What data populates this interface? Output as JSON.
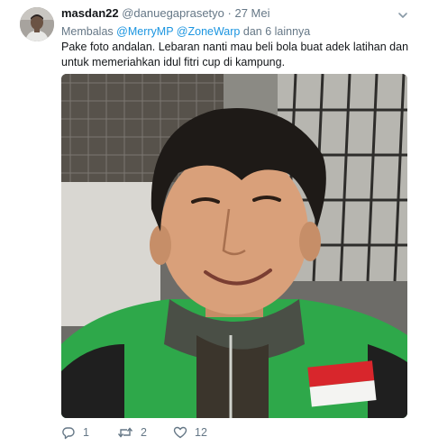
{
  "tweet": {
    "display_name": "masdan22",
    "handle": "@danuegaprasetyo",
    "separator": "·",
    "date": "27 Mei",
    "reply_prefix": "Membalas",
    "reply_mention_1": "@MerryMP",
    "reply_mention_2": "@ZoneWarp",
    "reply_suffix": "dan 6 lainnya",
    "text": "Pake foto andalan. Lebaran nanti mau beli bola buat adek latihan dan untuk memeriahkan idul fitri cup di kampung.",
    "reply_count": "1",
    "retweet_count": "2",
    "like_count": "12"
  },
  "icons": {
    "avatar": "avatar",
    "caret": "chevron-down-icon",
    "reply": "reply-icon",
    "retweet": "retweet-icon",
    "like": "heart-icon"
  },
  "colors": {
    "text": "#14171a",
    "muted": "#657786",
    "link": "#1b95e0",
    "jacket_green": "#2ea84a",
    "flag_red": "#d8262c"
  }
}
